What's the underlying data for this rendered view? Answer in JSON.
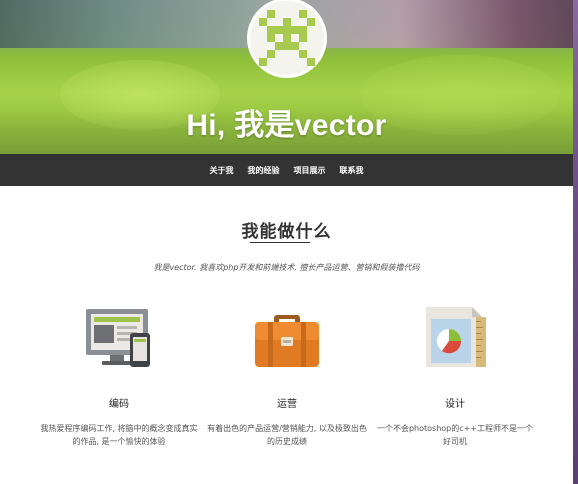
{
  "hero": {
    "title": "Hi, 我是vector"
  },
  "nav": {
    "items": [
      "关于我",
      "我的经验",
      "项目展示",
      "联系我"
    ]
  },
  "about": {
    "title": "我能做什么",
    "intro": "我是vector. 我喜欢php开发和前端技术. 擅长产品运营、营销和假装撸代码"
  },
  "features": [
    {
      "icon": "monitor-phone-icon",
      "title": "编码",
      "desc": "我热爱程序编码工作, 将脑中的概念变成真实的作品, 是一个愉快的体验"
    },
    {
      "icon": "briefcase-icon",
      "title": "运营",
      "desc": "有着出色的产品运营/营销能力, 以及极致出色的历史成绩"
    },
    {
      "icon": "chart-document-icon",
      "title": "设计",
      "desc": "一个不会photoshop的c++工程师不是一个好司机"
    }
  ],
  "colors": {
    "nav_bg": "#333333",
    "hero_green": "#a6d34a",
    "briefcase": "#e07b24"
  }
}
